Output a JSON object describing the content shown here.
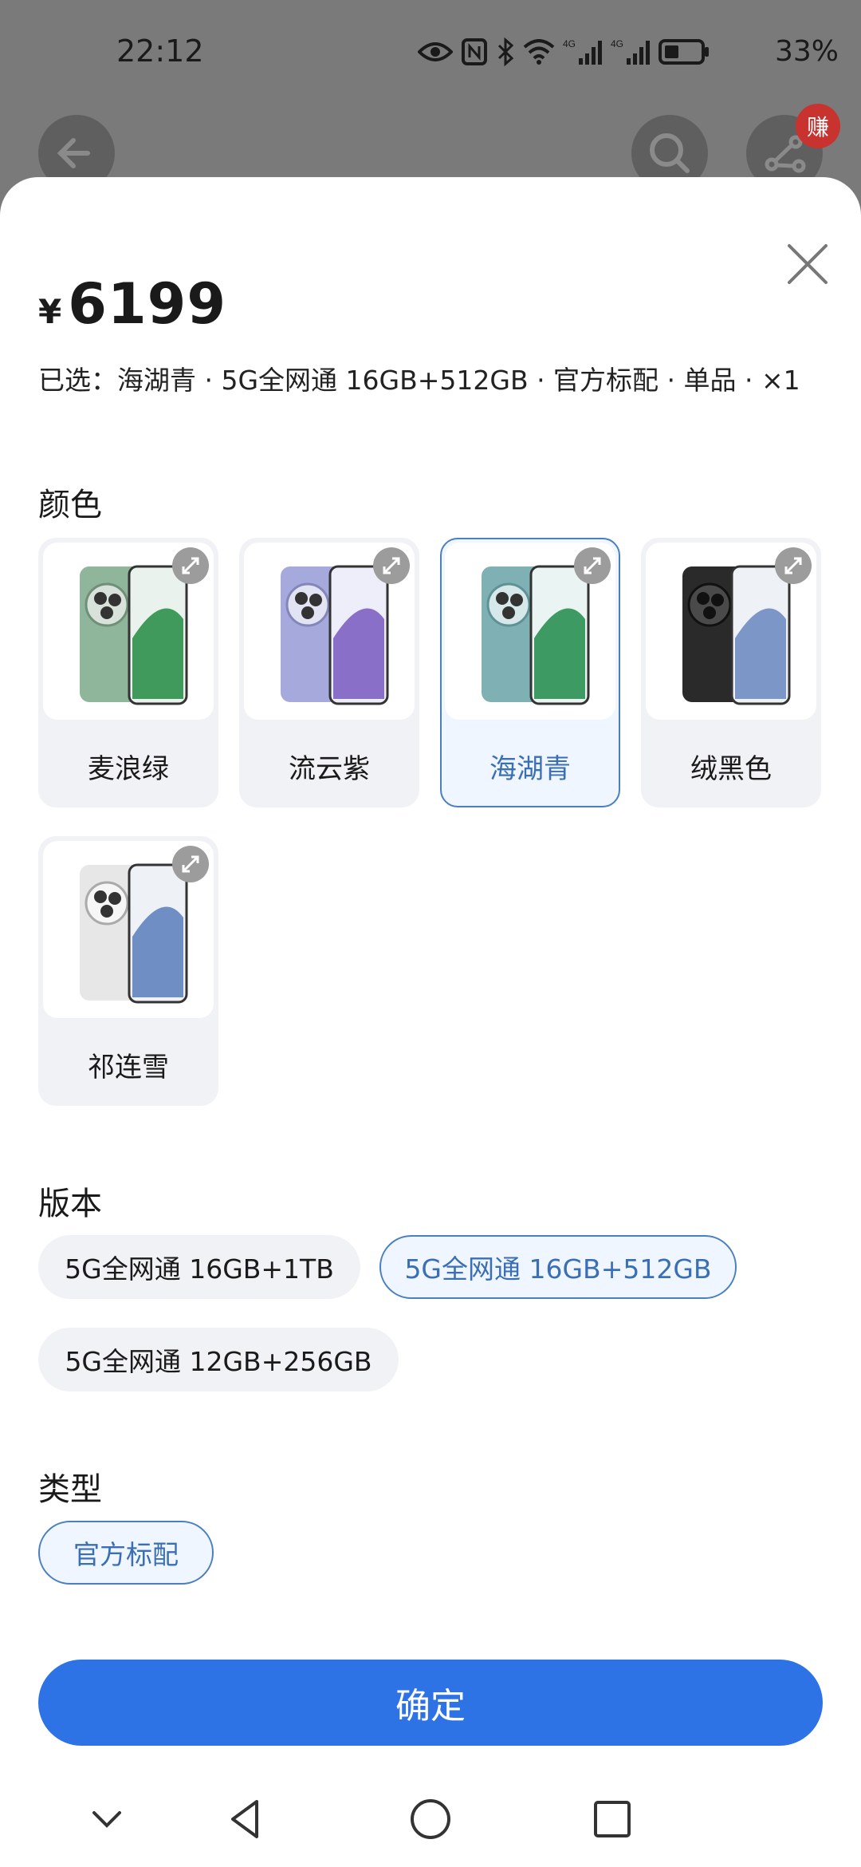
{
  "status_bar": {
    "time": "22:12",
    "icons": [
      "eye-icon",
      "nfc-icon",
      "bluetooth-icon",
      "wifi-icon",
      "signal-4g-icon",
      "signal-4g-icon",
      "battery-icon"
    ],
    "battery": "33%"
  },
  "background": {
    "earn_badge": "赚"
  },
  "sheet": {
    "price": {
      "currency": "¥",
      "amount": "6199"
    },
    "selected_summary": "已选：海湖青 · 5G全网通 16GB+512GB · 官方标配 · 单品 · ×1",
    "color_section": {
      "title": "颜色",
      "options": [
        {
          "label": "麦浪绿",
          "selected": false,
          "color": "#8fb59a"
        },
        {
          "label": "流云紫",
          "selected": false,
          "color": "#a6a9dc"
        },
        {
          "label": "海湖青",
          "selected": true,
          "color": "#7fb0b4"
        },
        {
          "label": "绒黑色",
          "selected": false,
          "color": "#2a2a2a"
        },
        {
          "label": "祁连雪",
          "selected": false,
          "color": "#e7e7e7"
        }
      ]
    },
    "version_section": {
      "title": "版本",
      "options": [
        {
          "label": "5G全网通 16GB+1TB",
          "selected": false
        },
        {
          "label": "5G全网通 16GB+512GB",
          "selected": true
        },
        {
          "label": "5G全网通 12GB+256GB",
          "selected": false
        }
      ]
    },
    "type_section": {
      "title": "类型",
      "options": [
        {
          "label": "官方标配",
          "selected": true
        }
      ]
    },
    "confirm_label": "确定"
  },
  "nav_bar": {
    "icons": [
      "chevron-down-icon",
      "back-triangle-icon",
      "home-circle-icon",
      "recents-square-icon"
    ]
  },
  "colors": {
    "accent": "#2e73e6",
    "selected_border": "#4a7fc1",
    "selected_text": "#3a6fb5",
    "chip_bg": "#f1f2f5"
  }
}
